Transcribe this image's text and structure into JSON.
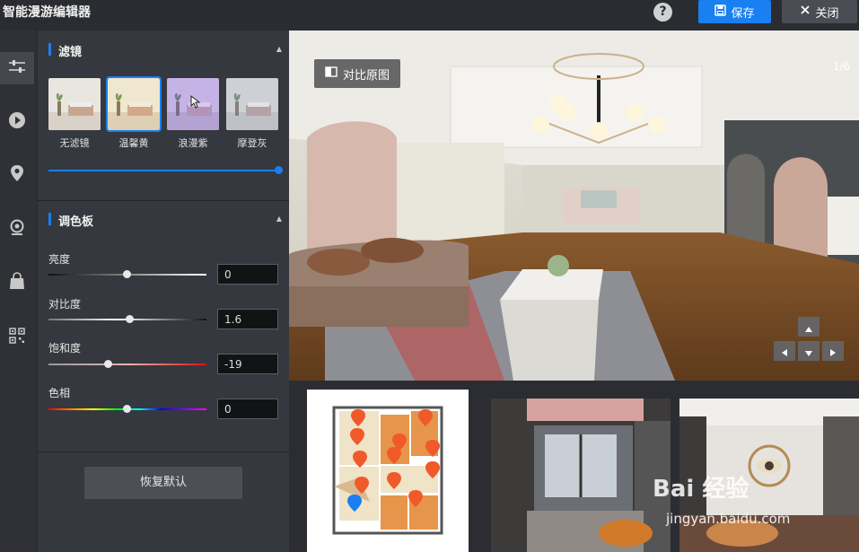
{
  "app": {
    "title": "智能漫游编辑器",
    "help_icon": "?",
    "save_label": "保存",
    "close_label": "关闭"
  },
  "rail": {
    "items": [
      {
        "name": "adjust-icon",
        "active": true
      },
      {
        "name": "play-icon",
        "active": false
      },
      {
        "name": "location-pin-icon",
        "active": false
      },
      {
        "name": "hotspot-icon",
        "active": false
      },
      {
        "name": "bag-icon",
        "active": false
      },
      {
        "name": "qrcode-icon",
        "active": false
      }
    ]
  },
  "filters": {
    "section_title": "滤镜",
    "items": [
      {
        "label": "无滤镜",
        "tint": "#e9e6e0",
        "selected": false
      },
      {
        "label": "温馨黄",
        "tint": "#efe7cf",
        "selected": true
      },
      {
        "label": "浪漫紫",
        "tint": "#c6b3e6",
        "selected": false
      },
      {
        "label": "摩登灰",
        "tint": "#cfd0d6",
        "selected": false
      }
    ],
    "intensity": 1.0
  },
  "palette": {
    "section_title": "调色板",
    "sliders": [
      {
        "label": "亮度",
        "value": "0",
        "position": 0.5
      },
      {
        "label": "对比度",
        "value": "1.6",
        "position": 0.52
      },
      {
        "label": "饱和度",
        "value": "-19",
        "position": 0.38
      },
      {
        "label": "色相",
        "value": "0",
        "position": 0.5
      }
    ],
    "reset_label": "恢复默认"
  },
  "viewer": {
    "compare_label": "对比原图",
    "page_counter": "1/6"
  },
  "watermark": {
    "brand": "Bai 经验",
    "url": "jingyan.baidu.com"
  },
  "colors": {
    "accent": "#1a7ff0",
    "panel": "#35383e",
    "pin": "#f05a2a"
  }
}
